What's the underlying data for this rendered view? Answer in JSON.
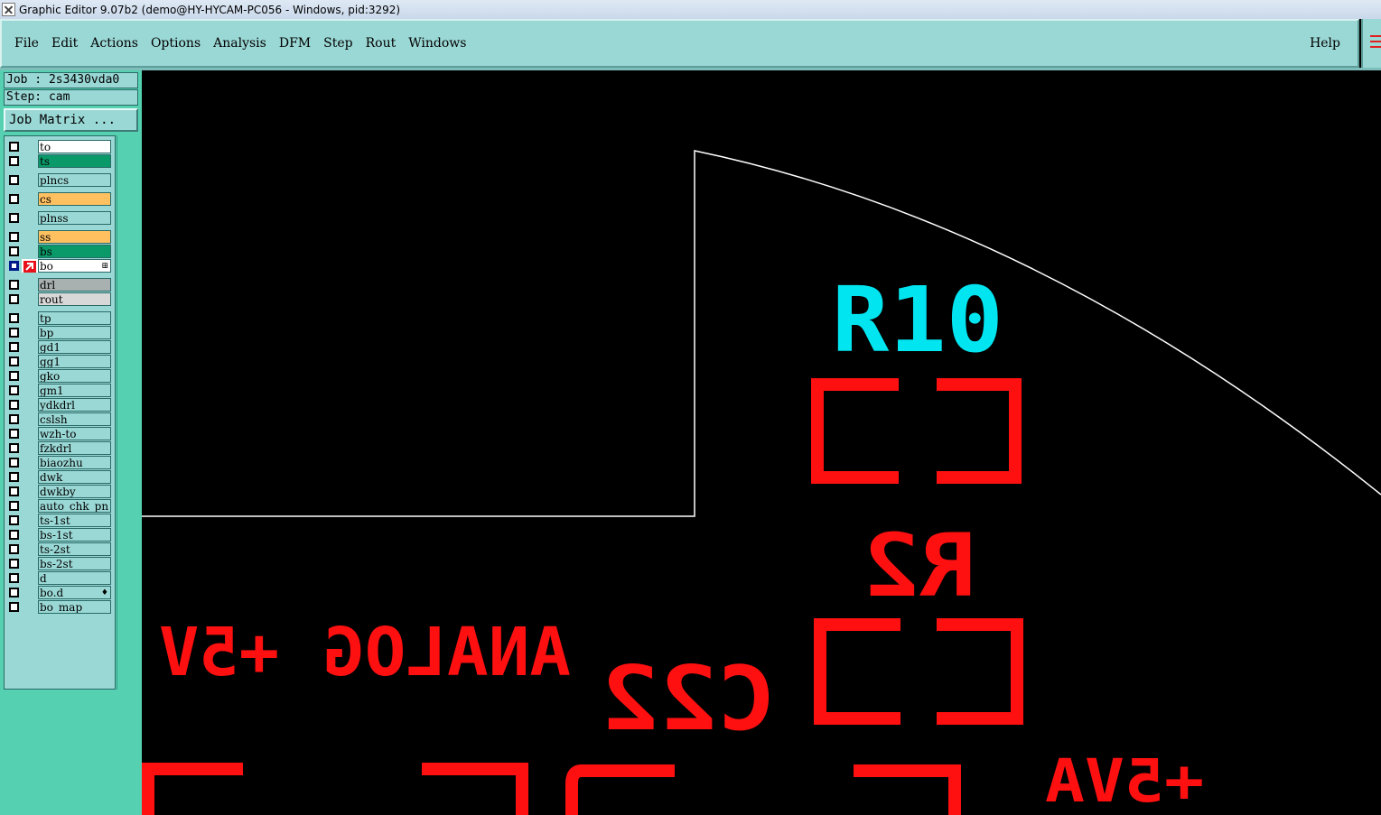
{
  "window": {
    "title": "Graphic Editor 9.07b2 (demo@HY-HYCAM-PC056 - Windows, pid:3292)"
  },
  "menu": {
    "items": [
      "File",
      "Edit",
      "Actions",
      "Options",
      "Analysis",
      "DFM",
      "Step",
      "Rout",
      "Windows"
    ],
    "help": "Help"
  },
  "panel": {
    "job_label": "Job : 2s3430vda0",
    "step_label": "Step: cam",
    "job_matrix": "Job Matrix ..."
  },
  "layers": [
    {
      "name": "to",
      "color": "#ffffff"
    },
    {
      "name": "ts",
      "color": "#0a9a6a"
    },
    {
      "name": "plncs",
      "color": "#9ad8d5"
    },
    {
      "name": "cs",
      "color": "#ffc060"
    },
    {
      "name": "plnss",
      "color": "#9ad8d5"
    },
    {
      "name": "ss",
      "color": "#ffc060"
    },
    {
      "name": "bs",
      "color": "#0a9a6a"
    },
    {
      "name": "bo",
      "color": "#ffffff",
      "active": true
    },
    {
      "name": "drl",
      "color": "#a8b0b0"
    },
    {
      "name": "rout",
      "color": "#d8d8d8"
    },
    {
      "name": "tp",
      "color": "#9ad8d5"
    },
    {
      "name": "bp",
      "color": "#9ad8d5"
    },
    {
      "name": "gd1",
      "color": "#9ad8d5"
    },
    {
      "name": "gg1",
      "color": "#9ad8d5"
    },
    {
      "name": "gko",
      "color": "#9ad8d5"
    },
    {
      "name": "gm1",
      "color": "#9ad8d5"
    },
    {
      "name": "ydkdrl",
      "color": "#9ad8d5"
    },
    {
      "name": "cslsh",
      "color": "#9ad8d5"
    },
    {
      "name": "wzh-to",
      "color": "#9ad8d5"
    },
    {
      "name": "fzkdrl",
      "color": "#9ad8d5"
    },
    {
      "name": "biaozhu",
      "color": "#9ad8d5"
    },
    {
      "name": "dwk",
      "color": "#9ad8d5"
    },
    {
      "name": "dwkby",
      "color": "#9ad8d5"
    },
    {
      "name": "auto_chk_pn",
      "color": "#9ad8d5"
    },
    {
      "name": "ts-1st",
      "color": "#9ad8d5"
    },
    {
      "name": "bs-1st",
      "color": "#9ad8d5"
    },
    {
      "name": "ts-2st",
      "color": "#9ad8d5"
    },
    {
      "name": "bs-2st",
      "color": "#9ad8d5"
    },
    {
      "name": "d",
      "color": "#9ad8d5"
    },
    {
      "name": "bo.d",
      "color": "#9ad8d5"
    },
    {
      "name": "bo_map",
      "color": "#9ad8d5"
    }
  ],
  "canvas": {
    "labels": {
      "r10": "R10",
      "r2": "R2",
      "c22": "C22",
      "analog": "ANALOG",
      "plus5v": "+5V",
      "plus5va": "+5VA"
    },
    "colors": {
      "silk_top": "#00e5f0",
      "silk_bottom": "#ff1010",
      "outline": "#ffffff"
    }
  }
}
